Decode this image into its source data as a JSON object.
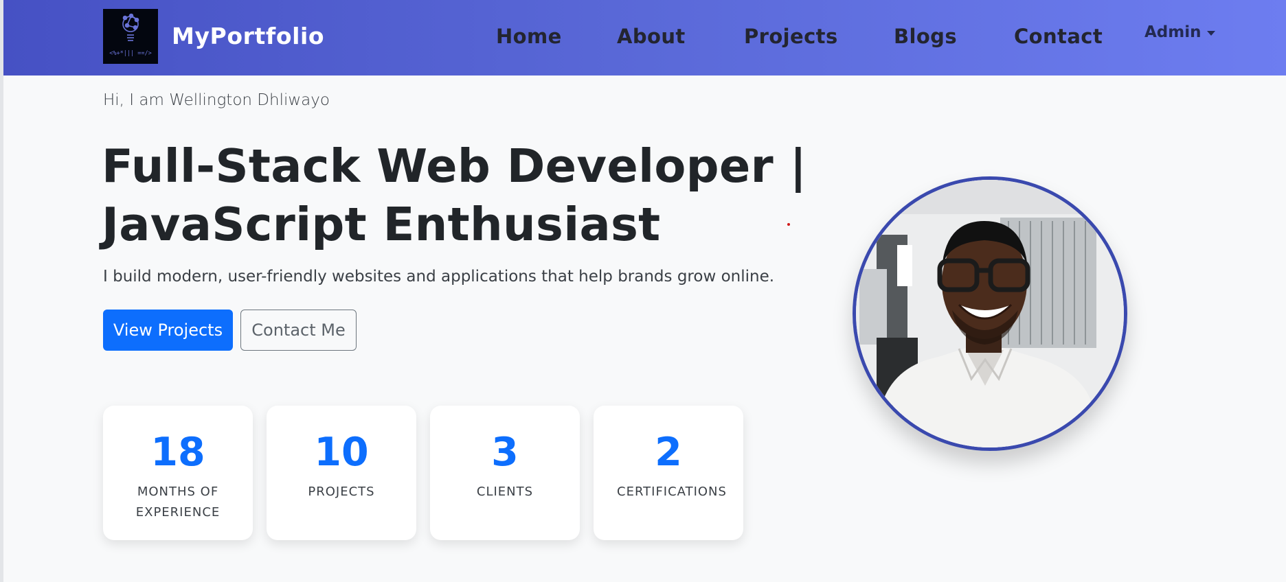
{
  "navbar": {
    "logo_icon": "lightbulb-code-logo-icon",
    "logo_caption": "<%+*||| ==/>",
    "brand": "MyPortfolio",
    "links": [
      "Home",
      "About",
      "Projects",
      "Blogs",
      "Contact"
    ],
    "admin": "Admin",
    "gradient_colors": [
      "#4651c4",
      "#6d7df0"
    ]
  },
  "hero": {
    "greeting": "Hi, I am Wellington Dhliwayo",
    "headline_line1": "Full-Stack Web Developer |",
    "headline_line2": "JavaScript Enthusiast",
    "tagline": "I build modern, user-friendly websites and applications that help brands grow online.",
    "primary_button": "View Projects",
    "secondary_button": "Contact Me",
    "accent_color": "#0d6efd"
  },
  "stats": [
    {
      "value": "18",
      "label": "Months of Experience"
    },
    {
      "value": "10",
      "label": "Projects"
    },
    {
      "value": "3",
      "label": "Clients"
    },
    {
      "value": "2",
      "label": "Certifications"
    }
  ],
  "profile": {
    "photo_icon": "profile-photo",
    "border_color": "#3a49ae"
  }
}
